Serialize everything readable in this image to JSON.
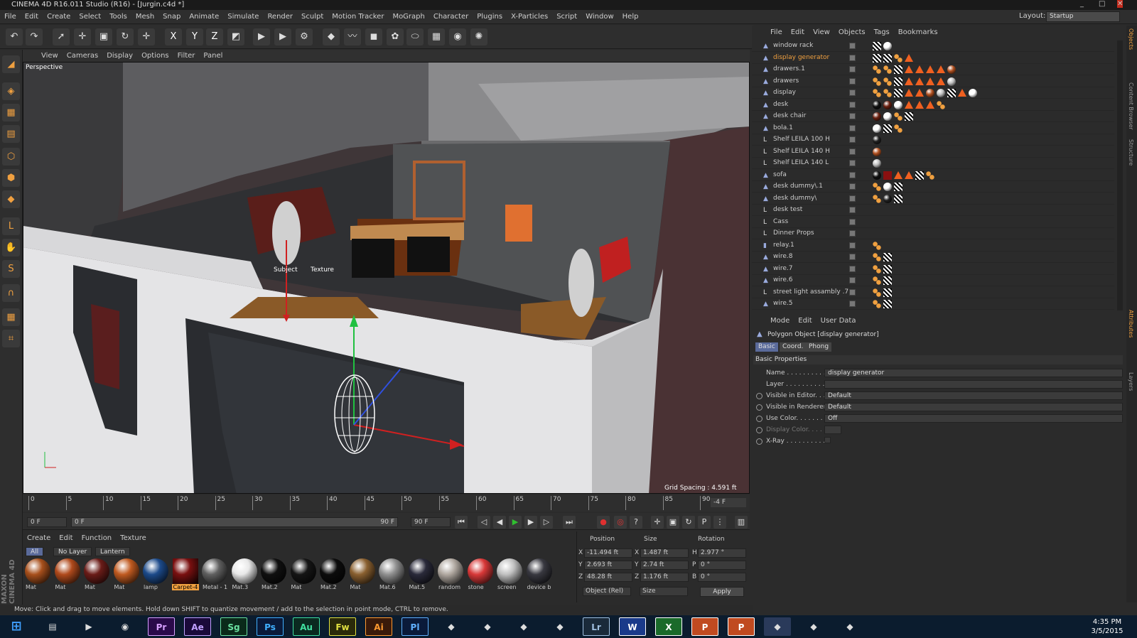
{
  "window": {
    "title": "CINEMA 4D R16.011 Studio (R16) - [Jurgin.c4d *]"
  },
  "menubar": [
    "File",
    "Edit",
    "Create",
    "Select",
    "Tools",
    "Mesh",
    "Snap",
    "Animate",
    "Simulate",
    "Render",
    "Sculpt",
    "Motion Tracker",
    "MoGraph",
    "Character",
    "Plugins",
    "X-Particles",
    "Script",
    "Window",
    "Help"
  ],
  "layout": {
    "label": "Layout:",
    "value": "Startup"
  },
  "viewport": {
    "menu": [
      "View",
      "Cameras",
      "Display",
      "Options",
      "Filter",
      "Panel"
    ],
    "name": "Perspective",
    "grid_spacing": "Grid Spacing : 4.591 ft",
    "labels": {
      "a": "Subject",
      "b": "Texture"
    }
  },
  "timeline": {
    "ticks": [
      "0",
      "5",
      "10",
      "15",
      "20",
      "25",
      "30",
      "35",
      "40",
      "45",
      "50",
      "55",
      "60",
      "65",
      "70",
      "75",
      "80",
      "85",
      "90"
    ],
    "current": "-4 F",
    "start": "0 F",
    "range_start": "0 F",
    "range_end": "90 F",
    "end": "90 F"
  },
  "materials": {
    "menu": [
      "Create",
      "Edit",
      "Function",
      "Texture"
    ],
    "tabs": [
      "All",
      "No Layer",
      "Lantern"
    ],
    "items": [
      {
        "label": "Mat",
        "color": "#a8501c"
      },
      {
        "label": "Mat",
        "color": "#b04a1c"
      },
      {
        "label": "Mat",
        "color": "#6a1c18"
      },
      {
        "label": "Mat",
        "color": "#c05a20"
      },
      {
        "label": "lamp",
        "color": "#1c4a8a"
      },
      {
        "label": "Carpet-4",
        "color": "#7a1010"
      },
      {
        "label": "Metal - 1",
        "color": "#606060"
      },
      {
        "label": "Mat.3",
        "color": "#e8e8e8"
      },
      {
        "label": "Mat.2",
        "color": "#101010"
      },
      {
        "label": "Mat",
        "color": "#151515"
      },
      {
        "label": "Mat.2",
        "color": "#0c0c0c"
      },
      {
        "label": "Mat",
        "color": "#8a6030"
      },
      {
        "label": "Mat.6",
        "color": "#909090"
      },
      {
        "label": "Mat.5",
        "color": "#2a2a3a"
      },
      {
        "label": "random",
        "color": "#b0a8a0"
      },
      {
        "label": "stone",
        "color": "#d83838"
      },
      {
        "label": "screen",
        "color": "#c0c0c0"
      },
      {
        "label": "device b",
        "color": "#383840"
      }
    ]
  },
  "coords": {
    "headers": [
      "Position",
      "Size",
      "Rotation"
    ],
    "rows": [
      {
        "axis": "X",
        "pos": "-11.494 ft",
        "saxis": "X",
        "size": "1.487 ft",
        "raxis": "H",
        "rot": "2.977 °"
      },
      {
        "axis": "Y",
        "pos": "2.693 ft",
        "saxis": "Y",
        "size": "2.74 ft",
        "raxis": "P",
        "rot": "0 °"
      },
      {
        "axis": "Z",
        "pos": "48.28 ft",
        "saxis": "Z",
        "size": "1.176 ft",
        "raxis": "B",
        "rot": "0 °"
      }
    ],
    "mode": "Object (Rel)",
    "size_mode": "Size",
    "apply": "Apply"
  },
  "status": "Move: Click and drag to move elements. Hold down SHIFT to quantize movement / add to the selection in point mode, CTRL to remove.",
  "maxon": "MAXON CINEMA 4D",
  "objects": {
    "menu": [
      "File",
      "Edit",
      "View",
      "Objects",
      "Tags",
      "Bookmarks"
    ],
    "rows": [
      {
        "name": "window rack",
        "icon": "poly",
        "selected": false
      },
      {
        "name": "display generator",
        "icon": "poly",
        "selected": true
      },
      {
        "name": "drawers.1",
        "icon": "poly",
        "selected": false
      },
      {
        "name": "drawers",
        "icon": "poly",
        "selected": false
      },
      {
        "name": "display",
        "icon": "poly",
        "selected": false
      },
      {
        "name": "desk",
        "icon": "poly",
        "selected": false
      },
      {
        "name": "desk chair",
        "icon": "poly",
        "selected": false
      },
      {
        "name": "bola.1",
        "icon": "poly",
        "selected": false
      },
      {
        "name": "Shelf LEILA 100 H",
        "icon": "null",
        "selected": false
      },
      {
        "name": "Shelf LEILA 140 H",
        "icon": "null",
        "selected": false
      },
      {
        "name": "Shelf LEILA 140 L",
        "icon": "null",
        "selected": false
      },
      {
        "name": "sofa",
        "icon": "poly",
        "selected": false
      },
      {
        "name": "desk dummy\\.1",
        "icon": "poly",
        "selected": false
      },
      {
        "name": "desk dummy\\",
        "icon": "poly",
        "selected": false
      },
      {
        "name": "desk test",
        "icon": "null",
        "selected": false
      },
      {
        "name": "Cass",
        "icon": "null",
        "selected": false
      },
      {
        "name": "Dinner Props",
        "icon": "null",
        "selected": false
      },
      {
        "name": "relay.1",
        "icon": "cyl",
        "selected": false
      },
      {
        "name": "wire.8",
        "icon": "poly",
        "selected": false
      },
      {
        "name": "wire.7",
        "icon": "poly",
        "selected": false
      },
      {
        "name": "wire.6",
        "icon": "poly",
        "selected": false
      },
      {
        "name": "street light assambly .7",
        "icon": "null",
        "selected": false
      },
      {
        "name": "wire.5",
        "icon": "poly",
        "selected": false
      }
    ]
  },
  "attributes": {
    "menu": [
      "Mode",
      "Edit",
      "User Data"
    ],
    "title": "Polygon Object [display generator]",
    "tabs": [
      "Basic",
      "Coord.",
      "Phong"
    ],
    "section": "Basic Properties",
    "props": [
      {
        "label": "Name . . . . . . . . . . . .",
        "value": "display generator"
      },
      {
        "label": "Layer . . . . . . . . . . . .",
        "value": ""
      },
      {
        "label": "Visible in Editor. . .",
        "value": "Default"
      },
      {
        "label": "Visible in Renderer",
        "value": "Default"
      },
      {
        "label": "Use Color. . . . . . . .",
        "value": "Off"
      },
      {
        "label": "Display Color. . . .",
        "value": ""
      },
      {
        "label": "X-Ray . . . . . . . . . . .",
        "value": ""
      }
    ]
  },
  "right_tabs": [
    "Objects",
    "Content Browser",
    "Structure",
    "Attributes",
    "Layers"
  ],
  "taskbar": {
    "apps": [
      "Start",
      "Explorer",
      "Media",
      "Chrome",
      "Pr",
      "Ae",
      "Sg",
      "Ps",
      "Au",
      "Fw",
      "Ai",
      "Pl",
      "Encore",
      "Acrobat",
      "Acrobat Pro",
      "DaVinci",
      "Lr",
      "W",
      "X",
      "P",
      "P",
      "Cinema 4D",
      "Zbrush",
      "Painter"
    ],
    "time": "4:35 PM",
    "date": "3/5/2015"
  }
}
